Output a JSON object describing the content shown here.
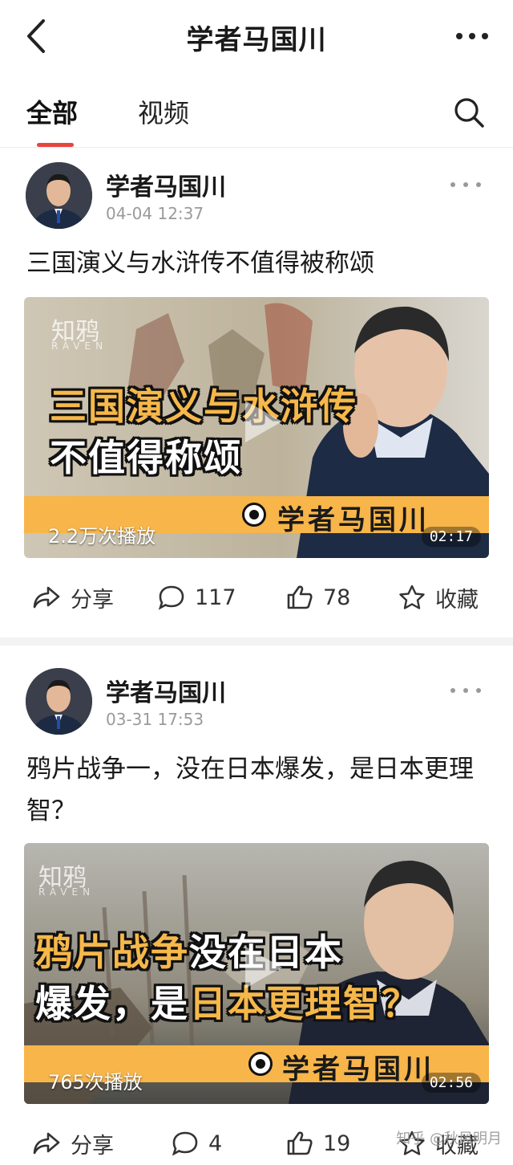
{
  "header": {
    "title": "学者马国川",
    "back_icon": "back-arrow-icon",
    "more_icon": "more-dots-icon"
  },
  "tabs": [
    {
      "label": "全部",
      "active": true
    },
    {
      "label": "视频",
      "active": false
    }
  ],
  "accent_color": "#e8453c",
  "posts": [
    {
      "author": "学者马国川",
      "time": "04-04 12:37",
      "title": "三国演义与水浒传不值得被称颂",
      "video": {
        "watermark": "知鸦",
        "watermark_sub": "RAVEN",
        "cover_line1": "三国演义与水浒传",
        "cover_line2": "不值得称颂",
        "banner_name": "学者马国川",
        "play_count": "2.2万次播放",
        "duration": "02:17"
      },
      "actions": {
        "share": "分享",
        "comments": "117",
        "likes": "78",
        "favorite": "收藏"
      }
    },
    {
      "author": "学者马国川",
      "time": "03-31 17:53",
      "title": "鸦片战争一，没在日本爆发，是日本更理智？",
      "video": {
        "watermark": "知鸦",
        "watermark_sub": "RAVEN",
        "cover_line1_a": "鸦片战争",
        "cover_line1_b": "没在日本",
        "cover_line2_a": "爆发，是",
        "cover_line2_b": "日本更理智？",
        "banner_name": "学者马国川",
        "play_count": "765次播放",
        "duration": "02:56"
      },
      "actions": {
        "share": "分享",
        "comments": "4",
        "likes": "19",
        "favorite": "收藏"
      }
    }
  ],
  "site_watermark": "知乎 @",
  "site_watermark_user": "秋风明月"
}
